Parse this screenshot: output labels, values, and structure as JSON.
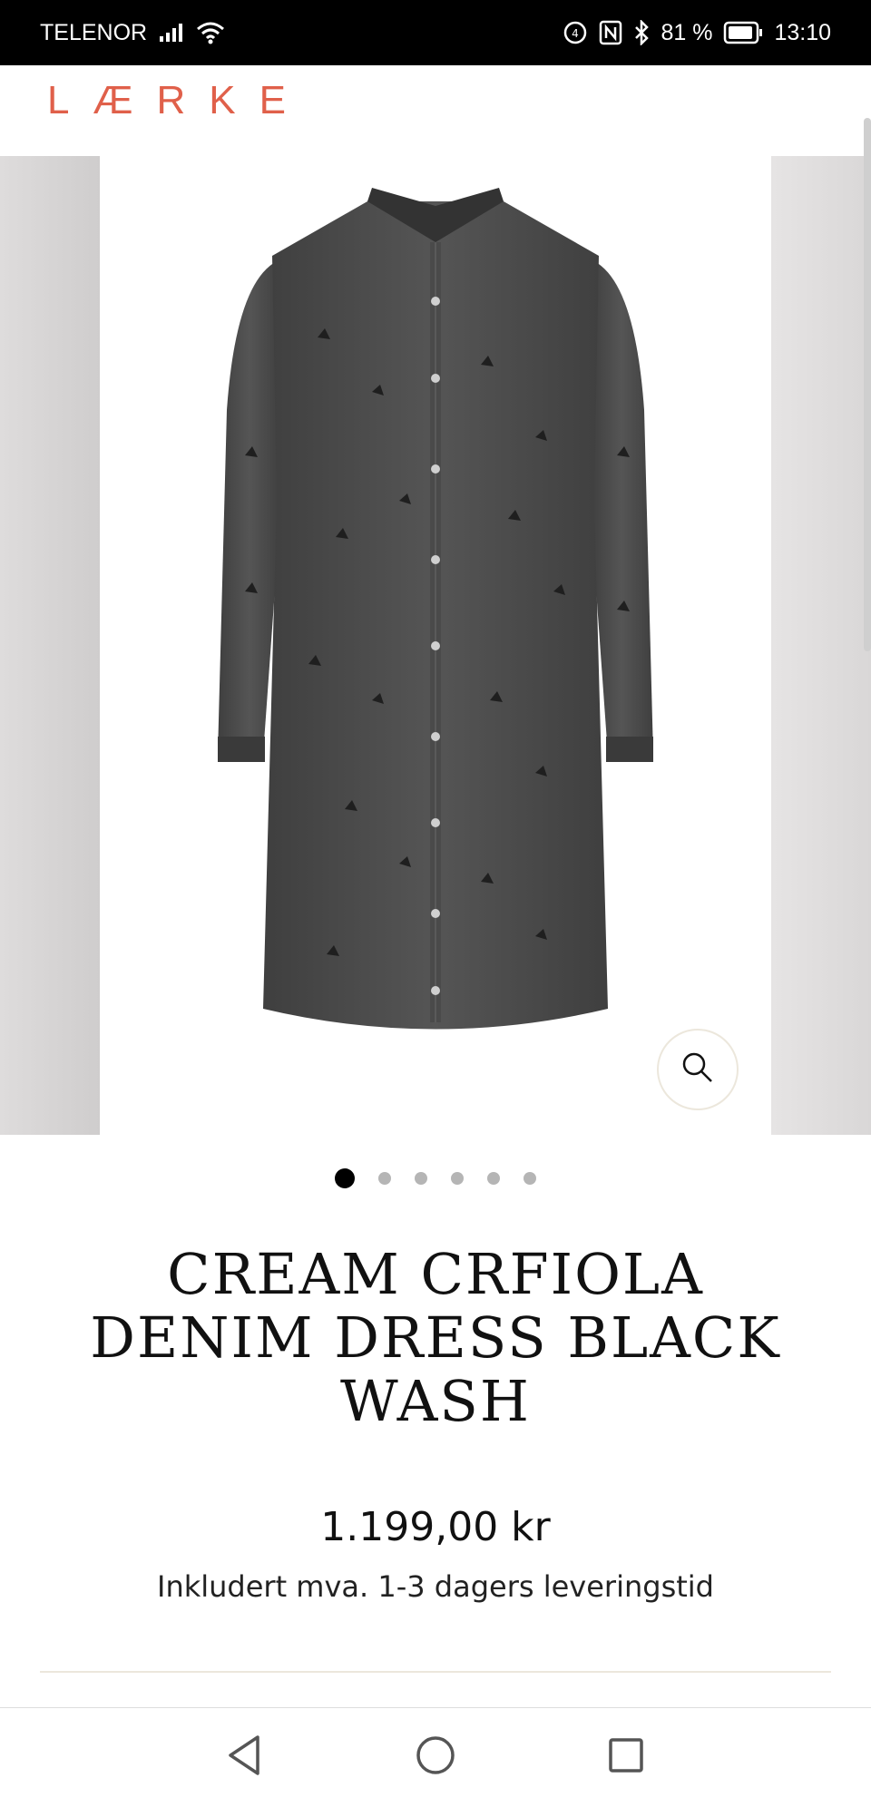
{
  "status_bar": {
    "carrier": "TELENOR",
    "battery_text": "81 %",
    "time": "13:10",
    "icons": [
      "signal-icon",
      "wifi-icon",
      "nfc-icon",
      "bluetooth-icon",
      "battery-icon"
    ]
  },
  "header": {
    "logo": "LÆRKE"
  },
  "gallery": {
    "zoom_icon": "search-icon",
    "dot_count": 6,
    "active_index": 0
  },
  "product": {
    "title": "CREAM CRFIOLA DENIM DRESS BLACK WASH",
    "price": "1.199,00 kr",
    "subinfo": "Inkludert mva. 1-3 dagers leveringstid"
  },
  "nav_bar": {
    "icons": [
      "back-icon",
      "home-icon",
      "recents-icon"
    ]
  },
  "colors": {
    "brand": "#e0604a",
    "status_bar_bg": "#000000",
    "dress": "#4b4b4b"
  }
}
